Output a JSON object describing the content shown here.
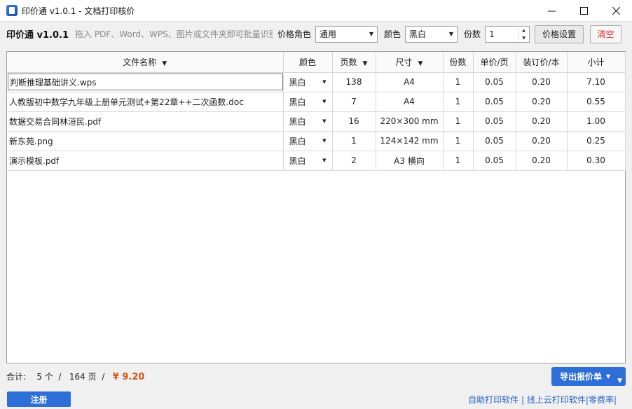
{
  "window": {
    "title": "印价通 v1.0.1 - 文档打印核价"
  },
  "toolbar": {
    "brand": "印价通 v1.0.1",
    "hint": "拖入 PDF、Word、WPS、图片或文件夹即可批量识别",
    "price_role_label": "价格角色",
    "price_role_value": "通用",
    "color_label": "颜色",
    "color_value": "黑白",
    "copies_label": "份数",
    "copies_value": "1",
    "price_settings_label": "价格设置",
    "clear_label": "清空"
  },
  "table": {
    "headers": {
      "name": "文件名称",
      "color": "颜色",
      "pages": "页数",
      "size": "尺寸",
      "copies": "份数",
      "unit_price": "单价/页",
      "binding": "装订价/本",
      "subtotal": "小计"
    },
    "rows": [
      {
        "name": "判断推理基础讲义.wps",
        "color": "黑白",
        "pages": "138",
        "size": "A4",
        "copies": "1",
        "unit_price": "0.05",
        "binding": "0.20",
        "subtotal": "7.10"
      },
      {
        "name": "人教版初中数学九年级上册单元测试+第22章++二次函数.doc",
        "color": "黑白",
        "pages": "7",
        "size": "A4",
        "copies": "1",
        "unit_price": "0.05",
        "binding": "0.20",
        "subtotal": "0.55"
      },
      {
        "name": "数据交易合同林洹民.pdf",
        "color": "黑白",
        "pages": "16",
        "size": "220×300 mm",
        "copies": "1",
        "unit_price": "0.05",
        "binding": "0.20",
        "subtotal": "1.00"
      },
      {
        "name": "新东苑.png",
        "color": "黑白",
        "pages": "1",
        "size": "124×142 mm",
        "copies": "1",
        "unit_price": "0.05",
        "binding": "0.20",
        "subtotal": "0.25"
      },
      {
        "name": "演示模板.pdf",
        "color": "黑白",
        "pages": "2",
        "size": "A3 横向",
        "copies": "1",
        "unit_price": "0.05",
        "binding": "0.20",
        "subtotal": "0.30"
      }
    ]
  },
  "footer": {
    "total_label": "合计:",
    "file_count": "5 个",
    "sep1": "/",
    "page_count": "164 页",
    "sep2": "/",
    "total_price": "¥ 9.20",
    "export_label": "导出报价单"
  },
  "statusbar": {
    "register_label": "注册",
    "link_self_print": "自助打印软件",
    "link_cloud_print": "线上云打印软件",
    "link_zero_fee": "零费率"
  }
}
